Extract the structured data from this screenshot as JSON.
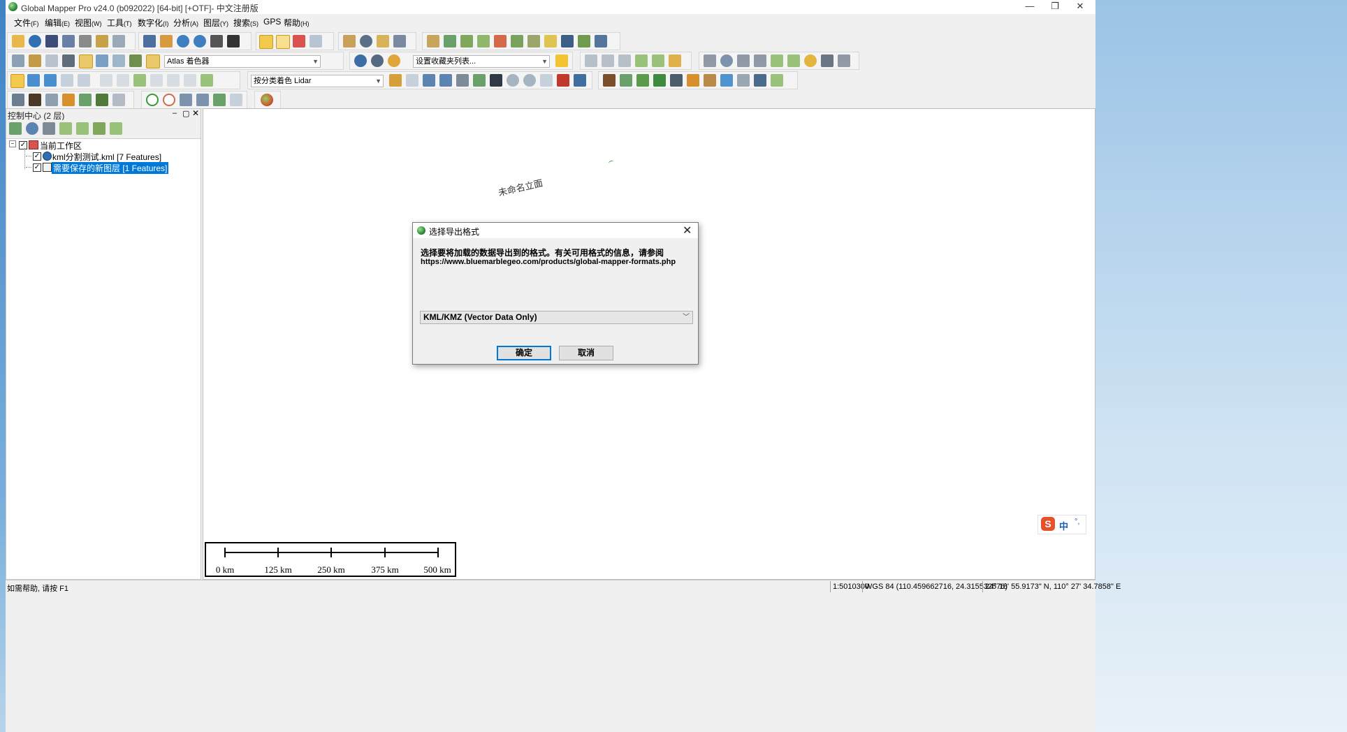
{
  "window": {
    "title": "Global Mapper Pro v24.0 (b092022) [64-bit] [+OTF]- 中文注册版",
    "controls": [
      "—",
      "❐",
      "✕"
    ]
  },
  "menu": [
    {
      "label": "文件",
      "key": "(F)"
    },
    {
      "label": "编辑",
      "key": "(E)"
    },
    {
      "label": "视图",
      "key": "(W)"
    },
    {
      "label": "工具",
      "key": "(T)"
    },
    {
      "label": "数字化",
      "key": "(I)"
    },
    {
      "label": "分析",
      "key": "(A)"
    },
    {
      "label": "图层",
      "key": "(Y)"
    },
    {
      "label": "搜索",
      "key": "(S)"
    },
    {
      "label": "GPS",
      "key": ""
    },
    {
      "label": "帮助",
      "key": "(H)"
    }
  ],
  "toolbars": {
    "shader_combo": "Atlas 着色器",
    "favorites_combo": "设置收藏夹列表...",
    "lidar_combo": "按分类着色 Lidar"
  },
  "control_center": {
    "title": "控制中心 (2 层)",
    "workspace": "当前工作区",
    "layers": [
      {
        "name": "kml分割测试.kml [7 Features]",
        "checked": true,
        "selected": false
      },
      {
        "name": "需要保存的新图层 [1 Features]",
        "checked": true,
        "selected": true
      }
    ]
  },
  "map": {
    "feature_label": "未命名立面",
    "scale_labels": [
      "0 km",
      "125 km",
      "250 km",
      "375 km",
      "500 km"
    ]
  },
  "ime": {
    "label": "中"
  },
  "status": {
    "help": "如需帮助, 请按 F1",
    "scale": "1:5010300",
    "projection": "WGS 84 (110.459662716, 24.315532576)",
    "dms": "24° 18' 55.9173\" N, 110° 27' 34.7858\" E"
  },
  "dialog": {
    "title": "选择导出格式",
    "message": "选择要将加载的数据导出到的格式。有关可用格式的信息，请参阅",
    "url": "https://www.bluemarblegeo.com/products/global-mapper-formats.php",
    "selected_format": "KML/KMZ (Vector Data Only)",
    "ok": "确定",
    "cancel": "取消"
  },
  "colors": {
    "selection": "#0078d7",
    "ok_border": "#0078d7"
  }
}
